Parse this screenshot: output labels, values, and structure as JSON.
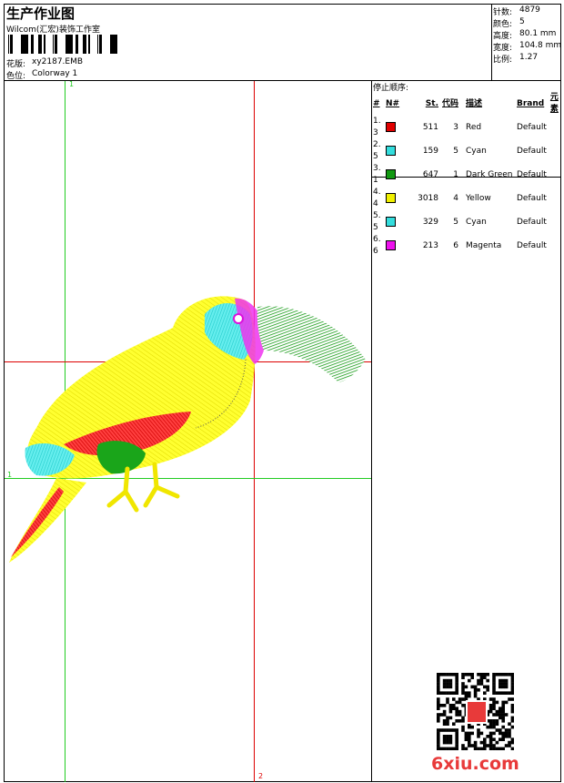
{
  "header": {
    "title": "生产作业图",
    "company": "Wilcom(汇宏)装饰工作室",
    "pattern_label": "花版:",
    "pattern_value": "xy2187.EMB",
    "color_label": "色位:",
    "color_value": "Colorway 1"
  },
  "stats": {
    "stitches_label": "针数:",
    "stitches_value": "4879",
    "colors_label": "颜色:",
    "colors_value": "5",
    "height_label": "高度:",
    "height_value": "80.1 mm",
    "width_label": "宽度:",
    "width_value": "104.8 mm",
    "scale_label": "比例:",
    "scale_value": "1.27"
  },
  "stop_sequence": {
    "title": "停止顺序:",
    "columns": [
      "#",
      "N#",
      "St.",
      "代码",
      "描述",
      "Brand",
      "元素"
    ],
    "rows": [
      {
        "idx": "1. 3",
        "color": "#e00000",
        "st": "511",
        "code": "3",
        "desc": "Red",
        "brand": "Default"
      },
      {
        "idx": "2. 5",
        "color": "#33dddd",
        "st": "159",
        "code": "5",
        "desc": "Cyan",
        "brand": "Default"
      },
      {
        "idx": "3. 1",
        "color": "#119911",
        "st": "647",
        "code": "1",
        "desc": "Dark Green",
        "brand": "Default"
      },
      {
        "idx": "4. 4",
        "color": "#f0f000",
        "st": "3018",
        "code": "4",
        "desc": "Yellow",
        "brand": "Default"
      },
      {
        "idx": "5. 5",
        "color": "#33dddd",
        "st": "329",
        "code": "5",
        "desc": "Cyan",
        "brand": "Default"
      },
      {
        "idx": "6. 6",
        "color": "#ee11ee",
        "st": "213",
        "code": "6",
        "desc": "Magenta",
        "brand": "Default"
      }
    ]
  },
  "guides": {
    "label_top": "1",
    "label_left": "1",
    "label_bottom": "2"
  },
  "watermark": {
    "text": "6xiu.com"
  },
  "colors": {
    "guide_green": "#22cc22",
    "guide_red": "#dd0000",
    "watermark_red": "#e83a3a"
  }
}
